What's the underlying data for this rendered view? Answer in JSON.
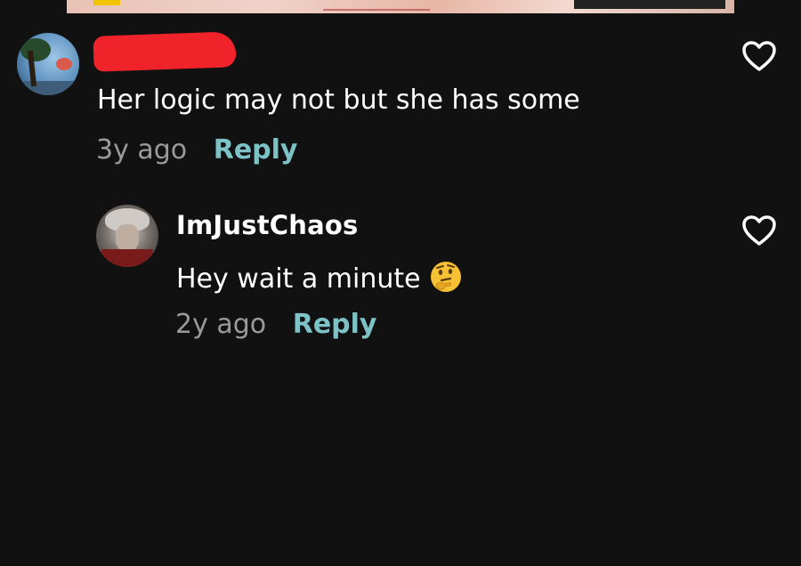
{
  "top_media": {
    "description_icon": "image-thumbnail"
  },
  "comments": [
    {
      "author": "",
      "author_redacted": true,
      "text": "Her logic may not but she has some",
      "timestamp": "3y ago",
      "reply_label": "Reply",
      "like_icon": "heart-outline-icon"
    },
    {
      "author": "ImJustChaos",
      "author_redacted": false,
      "text": "Hey wait a minute",
      "emoji": "thinking-face",
      "timestamp": "2y ago",
      "reply_label": "Reply",
      "like_icon": "heart-outline-icon"
    }
  ],
  "colors": {
    "background": "#111111",
    "text_primary": "#ffffff",
    "text_secondary": "#9a9a9a",
    "reply_accent": "#7cc2c6",
    "redaction": "#f0232b"
  }
}
